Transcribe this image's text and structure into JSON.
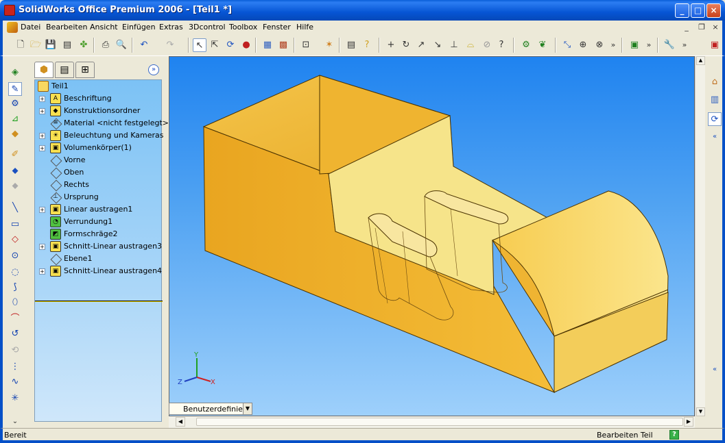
{
  "app": {
    "title": "SolidWorks Office Premium 2006 - [Teil1 *]",
    "window_controls": {
      "minimize": "_",
      "maximize": "□",
      "close": "×"
    }
  },
  "menu": {
    "items": [
      "Datei",
      "Bearbeiten",
      "Ansicht",
      "Einfügen",
      "Extras",
      "3Dcontrol",
      "Toolbox",
      "Fenster",
      "Hilfe"
    ],
    "mdi_controls": {
      "minimize": "_",
      "restore": "❐",
      "close": "×"
    }
  },
  "toolbar": {
    "overflow_marker": "»"
  },
  "feature_manager": {
    "expand_glyph": "»",
    "root": "Teil1",
    "tree": [
      {
        "label": "Beschriftung",
        "icon": "annotations-icon",
        "glyph": "A",
        "expandable": true
      },
      {
        "label": "Konstruktionsordner",
        "icon": "design-binder-icon",
        "glyph": "◆",
        "expandable": true
      },
      {
        "label": "Material <nicht festgelegt>",
        "icon": "material-icon",
        "glyph": "≡",
        "expandable": false
      },
      {
        "label": "Beleuchtung und Kameras",
        "icon": "lights-icon",
        "glyph": "☀",
        "expandable": true
      },
      {
        "label": "Volumenkörper(1)",
        "icon": "solid-bodies-icon",
        "glyph": "▣",
        "expandable": true
      },
      {
        "label": "Vorne",
        "icon": "plane-icon",
        "glyph": "",
        "expandable": false
      },
      {
        "label": "Oben",
        "icon": "plane-icon",
        "glyph": "",
        "expandable": false
      },
      {
        "label": "Rechts",
        "icon": "plane-icon",
        "glyph": "",
        "expandable": false
      },
      {
        "label": "Ursprung",
        "icon": "origin-icon",
        "glyph": "⊥",
        "expandable": false
      },
      {
        "label": "Linear austragen1",
        "icon": "extrude-icon",
        "glyph": "▣",
        "expandable": true
      },
      {
        "label": "Verrundung1",
        "icon": "fillet-icon",
        "glyph": "◔",
        "expandable": false
      },
      {
        "label": "Formschräge2",
        "icon": "draft-icon",
        "glyph": "◩",
        "expandable": false
      },
      {
        "label": "Schnitt-Linear austragen3",
        "icon": "cut-extrude-icon",
        "glyph": "▣",
        "expandable": true
      },
      {
        "label": "Ebene1",
        "icon": "plane-icon",
        "glyph": "",
        "expandable": false
      },
      {
        "label": "Schnitt-Linear austragen4",
        "icon": "cut-extrude-icon",
        "glyph": "▣",
        "expandable": true
      }
    ]
  },
  "viewport": {
    "view_tab": "Benutzerdefiniert",
    "triad": {
      "x": "X",
      "y": "Y",
      "z": "Z"
    },
    "background_top": "#1f83f0",
    "background_bottom": "#9ed0fb",
    "model_color": "#f2b830"
  },
  "status": {
    "left": "Bereit",
    "right": "Bearbeiten Teil",
    "help": "?"
  },
  "colors": {
    "titlebar": "#0a5fd8",
    "chrome": "#ece9d8"
  }
}
